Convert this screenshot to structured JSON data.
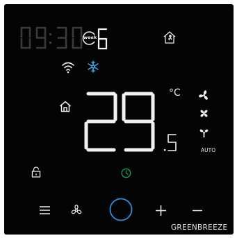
{
  "clock": {
    "time": "09:30",
    "week_label": "week",
    "day": "6",
    "display_mode": "dim"
  },
  "temperature": {
    "integer": "29",
    "decimal": "5",
    "unit": "°C"
  },
  "fan": {
    "mode_label": "AUTO"
  },
  "brand": {
    "name": "GREENBREEZE"
  },
  "colors": {
    "background": "#040404",
    "lit": "#f2f2f2",
    "dim": "#3a3a3a",
    "snow": "#3aa7e8",
    "timer": "#1aa35a"
  },
  "icons": [
    "home-away-icon",
    "wifi-icon",
    "snowflake-icon",
    "home-icon",
    "fan-high-icon",
    "fan-medium-icon",
    "fan-low-icon",
    "lock-icon",
    "timer-icon",
    "menu-icon",
    "fan-button-icon",
    "power-icon",
    "plus-icon",
    "minus-icon"
  ]
}
